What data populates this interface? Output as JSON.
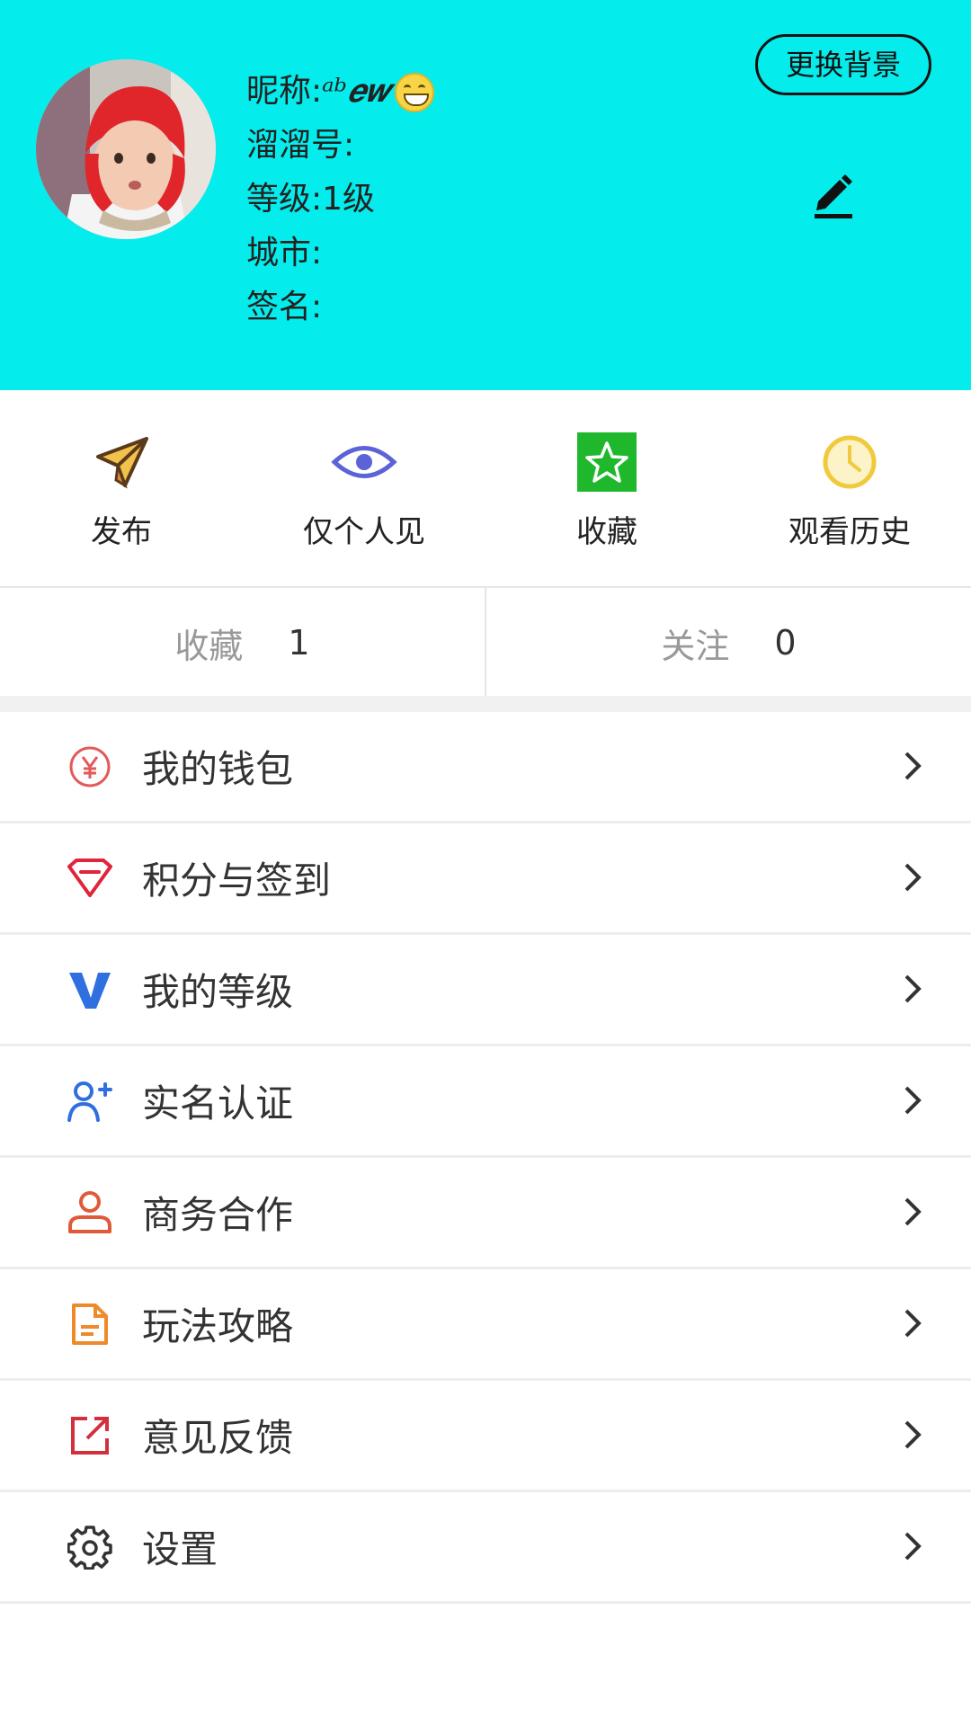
{
  "profile": {
    "nickname_label": "昵称:",
    "nickname_value": "ᵃᵇ𝒆𝒘",
    "liuliu_label": "溜溜号:",
    "level_label": "等级:1级",
    "city_label": "城市:",
    "signature_label": "签名:",
    "change_background": "更换背景"
  },
  "quick_actions": [
    {
      "label": "发布",
      "icon": "paper-plane-icon"
    },
    {
      "label": "仅个人见",
      "icon": "eye-icon"
    },
    {
      "label": "收藏",
      "icon": "star-icon"
    },
    {
      "label": "观看历史",
      "icon": "clock-icon"
    }
  ],
  "stats": {
    "favorites_label": "收藏",
    "favorites_count": "1",
    "following_label": "关注",
    "following_count": "0"
  },
  "menu": [
    {
      "label": "我的钱包",
      "icon": "yuan-icon",
      "color": "#e25a5a"
    },
    {
      "label": "积分与签到",
      "icon": "diamond-icon",
      "color": "#e0243a"
    },
    {
      "label": "我的等级",
      "icon": "v-level-icon",
      "color": "#2f6fe0"
    },
    {
      "label": "实名认证",
      "icon": "add-user-icon",
      "color": "#2f6fe0"
    },
    {
      "label": "商务合作",
      "icon": "person-icon",
      "color": "#e05a3a"
    },
    {
      "label": "玩法攻略",
      "icon": "document-icon",
      "color": "#ef8a2a"
    },
    {
      "label": "意见反馈",
      "icon": "external-link-icon",
      "color": "#d2303c"
    },
    {
      "label": "设置",
      "icon": "gear-icon",
      "color": "#333333"
    }
  ],
  "colors": {
    "header_bg": "#05ecec"
  }
}
